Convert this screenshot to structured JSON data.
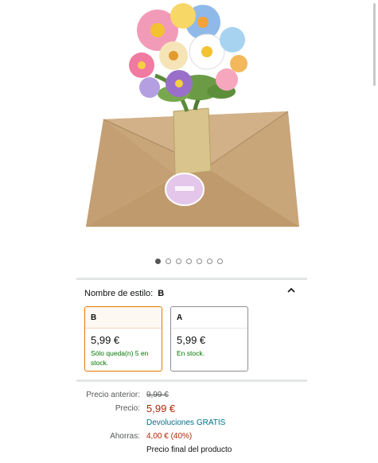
{
  "product": {
    "image_alt": "Tarjeta pop-up de ramo de flores sobre sobre kraft",
    "carousel": {
      "count": 7,
      "active_index": 0
    }
  },
  "style_selector": {
    "label": "Nombre de estilo:",
    "selected": "B",
    "expanded": true,
    "options": [
      {
        "name": "B",
        "price": "5,99 €",
        "availability": "Sólo queda(n) 5 en stock.",
        "selected": true
      },
      {
        "name": "A",
        "price": "5,99 €",
        "availability": "En stock.",
        "selected": false
      }
    ]
  },
  "pricing": {
    "previous_label": "Precio anterior:",
    "previous_value": "9,99 €",
    "price_label": "Precio:",
    "price_value": "5,99 €",
    "returns": "Devoluciones GRATIS",
    "savings_label": "Ahorras:",
    "savings_value": "4,00 € (40%)",
    "final_note": "Precio final del producto"
  },
  "colors": {
    "accent_orange": "#e77600",
    "price_red": "#b12704",
    "stock_green": "#007600",
    "link_teal": "#007185"
  }
}
